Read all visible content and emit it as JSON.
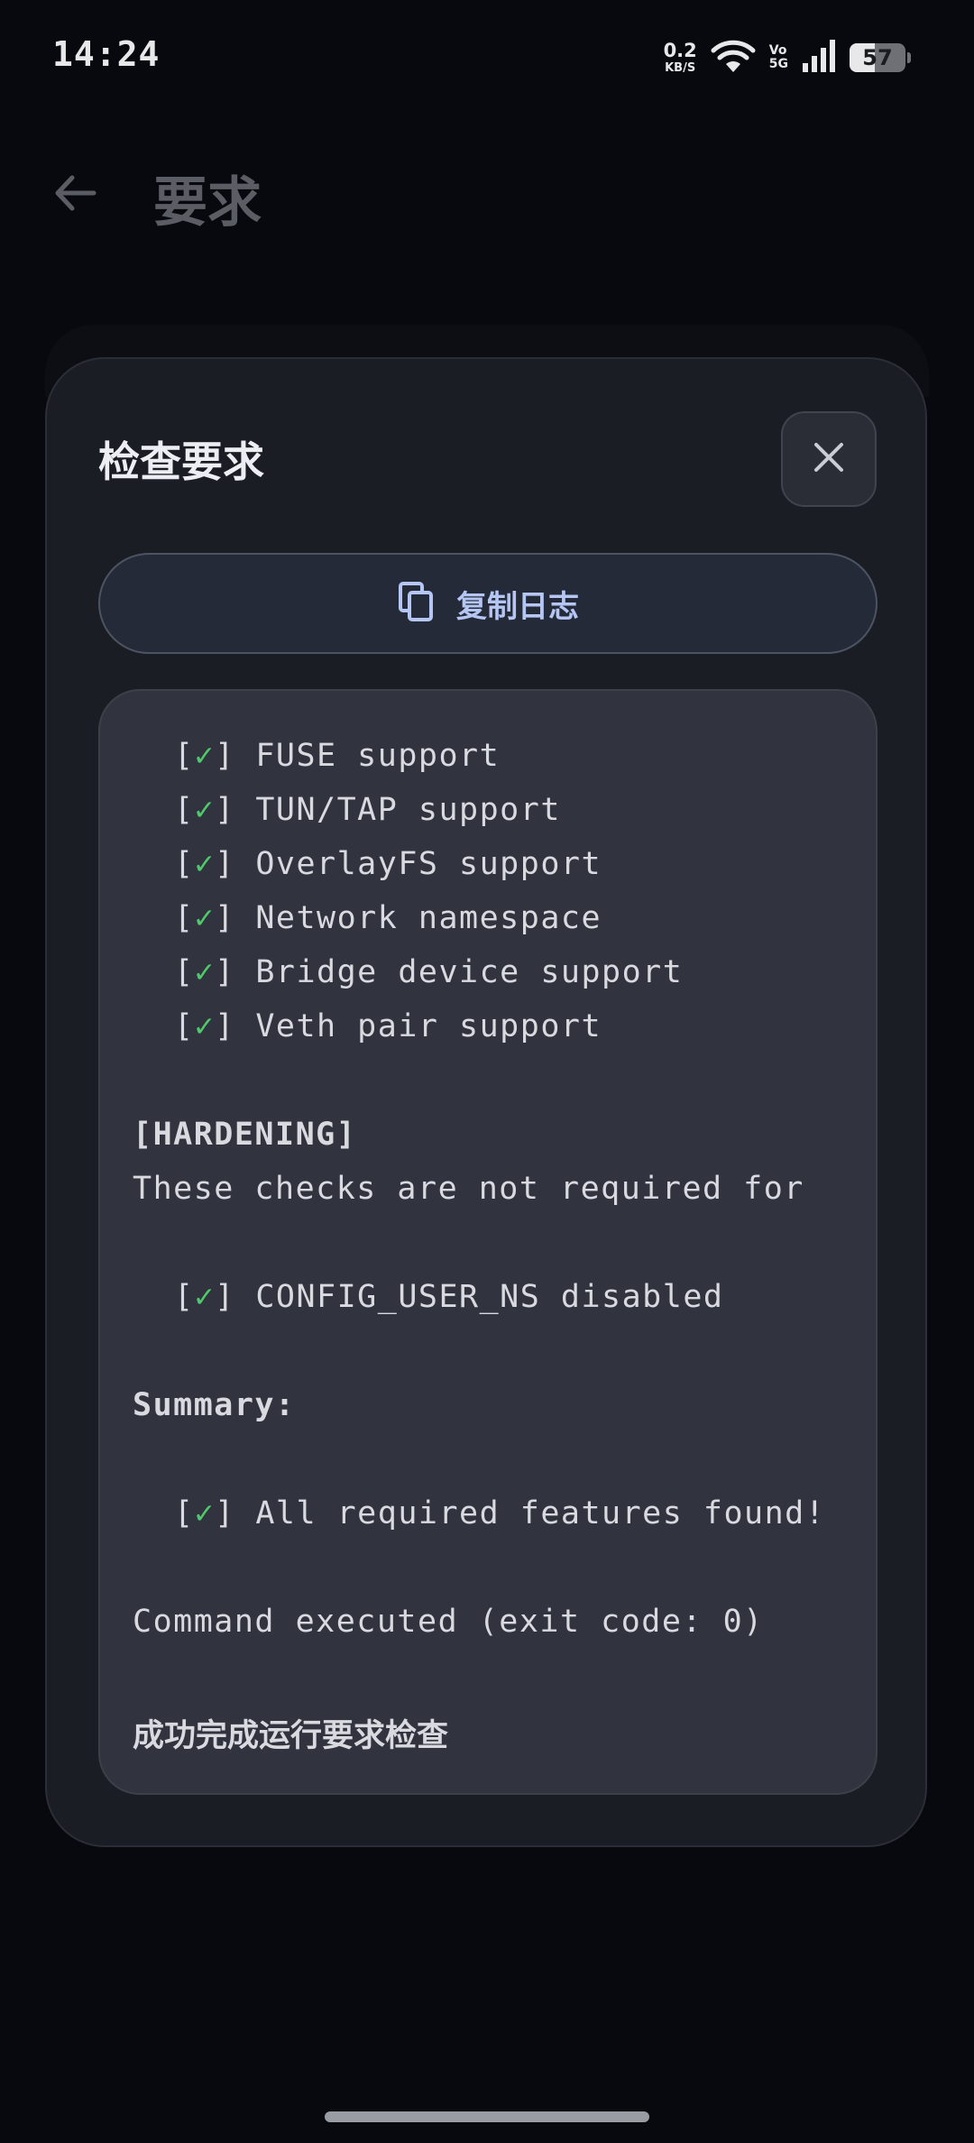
{
  "status_bar": {
    "time": "14:24",
    "net_speed_value": "0.2",
    "net_speed_unit": "KB/S",
    "volte_top": "Vo",
    "volte_bottom": "5G",
    "battery_level": "57"
  },
  "app_bar": {
    "title": "要求",
    "back_icon": "arrow-left-icon"
  },
  "dialog": {
    "title": "检查要求",
    "close_icon": "close-icon",
    "copy_button": {
      "label": "复制日志",
      "icon": "copy-icon"
    },
    "log": {
      "check_mark": "✓",
      "checks": [
        "FUSE support",
        "TUN/TAP support",
        "OverlayFS support",
        "Network namespace",
        "Bridge device support",
        "Veth pair support"
      ],
      "hardening_header": "[HARDENING]",
      "hardening_note": "These checks are not required for",
      "hardening_check": "CONFIG_USER_NS disabled",
      "summary_header": "Summary:",
      "summary_check": "All required features found!",
      "command_result": "Command executed (exit code: 0)",
      "completion_message": "成功完成运行要求检查"
    }
  },
  "colors": {
    "background": "#07090e",
    "dialog": "#1b1d25",
    "log_box": "#31333f",
    "accent_text": "#b6c6f4",
    "check_green": "#4fc96c"
  }
}
